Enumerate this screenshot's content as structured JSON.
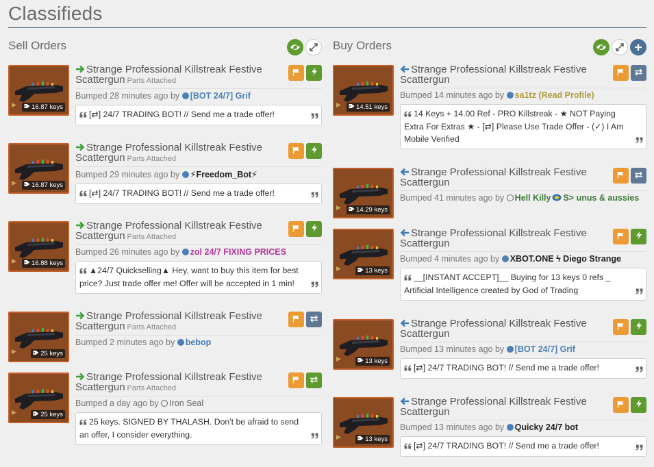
{
  "page": {
    "title": "Classifieds"
  },
  "colors": {
    "sell_arrow": "#3d9e36",
    "buy_arrow": "#3f7cb8",
    "orange": "#ec9a33",
    "green": "#5e9a2e",
    "slate": "#5f7896",
    "item_bg": "#8a4a22"
  },
  "sell": {
    "title": "Sell Orders",
    "tools": [
      "eye-icon",
      "expand-icon"
    ],
    "listings": [
      {
        "name": "Strange Professional Killstreak Festive Scattergun",
        "parts": "Parts Attached",
        "price": "16.87 keys",
        "bump_text": "Bumped 28 minutes ago by",
        "user": "[BOT 24/7] Grif",
        "user_color": "#4b7fb5",
        "comment": "[⇄] 24/7 TRADING BOT! // Send me a trade offer!",
        "action": "lightning"
      },
      {
        "name": "Strange Professional Killstreak Festive Scattergun",
        "parts": "Parts Attached",
        "price": "16.87 keys",
        "bump_text": "Bumped 29 minutes ago by",
        "user": "⚡Freedom_Bot⚡",
        "user_color": "#222222",
        "comment": "[⇄] 24/7 TRADING BOT! // Send me a trade offer!",
        "action": "lightning"
      },
      {
        "name": "Strange Professional Killstreak Festive Scattergun",
        "parts": "Parts Attached",
        "price": "16.88 keys",
        "bump_text": "Bumped 26 minutes ago by",
        "user": "zol 24/7 FIXING PRICES",
        "user_color": "#b5359c",
        "comment": "▲24/7 Quickselling▲ Hey, want to buy this item for best price? Just trade offer me! Offer will be accepted in 1 min!",
        "action": "lightning"
      },
      {
        "name": "Strange Professional Killstreak Festive Scattergun",
        "parts": "Parts Attached",
        "price": "25 keys",
        "bump_text": "Bumped 2 minutes ago by",
        "user": "bebop",
        "user_color": "#3f7cb8",
        "comment": "",
        "action": "swap"
      },
      {
        "name": "Strange Professional Killstreak Festive Scattergun",
        "parts": "Parts Attached",
        "price": "25 keys",
        "bump_text": "Bumped a day ago by",
        "user": "Iron Seal",
        "user_color": "#666666",
        "comment": "25 keys. SIGNED BY THALASH. Don't be afraid to send an offer, I consider everything.",
        "action": "swap-green"
      }
    ]
  },
  "buy": {
    "title": "Buy Orders",
    "tools": [
      "eye-icon",
      "expand-icon",
      "plus-icon"
    ],
    "listings": [
      {
        "name": "Strange Professional Killstreak Festive Scattergun",
        "price": "14.51 keys",
        "bump_text": "Bumped 14 minutes ago by",
        "user": "sa1tz (Read Profile)",
        "user_color": "#b29a3a",
        "comment": "14 Keys + 14.00 Ref - PRO Killstreak - ★ NOT Paying Extra For Extras ★ - [⇄] Please Use Trade Offer - (✓) I Am Mobile Verified",
        "action": "swap"
      },
      {
        "name": "Strange Professional Killstreak Festive Scattergun",
        "price": "14.29 keys",
        "bump_text": "Bumped 41 minutes ago by",
        "user": "Hell Killy",
        "user_suffix": "S> unus & aussies",
        "user_color": "#3e7a3a",
        "comment": "",
        "action": "swap"
      },
      {
        "name": "Strange Professional Killstreak Festive Scattergun",
        "price": "13 keys",
        "bump_text": "Bumped 4 minutes ago by",
        "user": "XBOT.ONE ϟ Diego Strange",
        "user_color": "#222222",
        "comment": "__[INSTANT ACCEPT]__ Buying for 13 keys 0 refs _ Artificial Intelligence created by God of Trading",
        "action": "lightning"
      },
      {
        "name": "Strange Professional Killstreak Festive Scattergun",
        "price": "13 keys",
        "bump_text": "Bumped 13 minutes ago by",
        "user": "[BOT 24/7] Grif",
        "user_color": "#4b7fb5",
        "comment": "[⇄] 24/7 TRADING BOT! // Send me a trade offer!",
        "action": "lightning"
      },
      {
        "name": "Strange Professional Killstreak Festive Scattergun",
        "price": "13 keys",
        "bump_text": "Bumped 13 minutes ago by",
        "user": "Quicky 24/7 bot",
        "user_color": "#222222",
        "comment": "[⇄] 24/7 TRADING BOT! // Send me a trade offer!",
        "action": "lightning"
      }
    ]
  }
}
